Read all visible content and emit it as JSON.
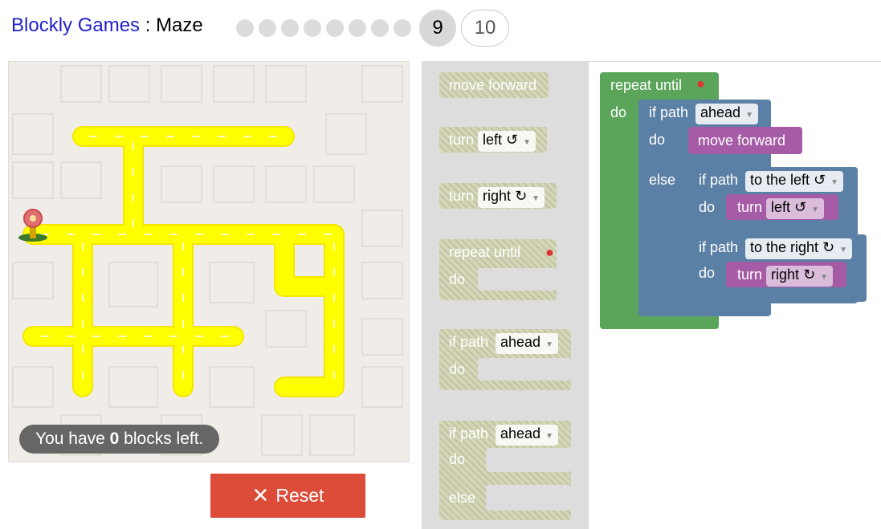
{
  "header": {
    "app_name": "Blockly Games",
    "separator": " : ",
    "game_name": "Maze",
    "current_level": "9",
    "next_level": "10",
    "completed_levels": 8
  },
  "maze": {
    "capacity_prefix": "You have ",
    "capacity_count": "0",
    "capacity_suffix": " blocks left."
  },
  "reset_label": "Reset",
  "toolbox": {
    "move_forward": "move forward",
    "turn": "turn",
    "left": "left ↺",
    "right": "right ↻",
    "repeat_until": "repeat until",
    "do": "do",
    "if_path": "if path",
    "ahead": "ahead",
    "else": "else"
  },
  "workspace": {
    "repeat_until": "repeat until",
    "do": "do",
    "if_path": "if path",
    "ahead": "ahead",
    "move_forward": "move forward",
    "else": "else",
    "to_the_left": "to the left ↺",
    "to_the_right": "to the right ↻",
    "turn": "turn",
    "left": "left ↺",
    "right": "right ↻"
  },
  "colors": {
    "path": "#ffff00",
    "loop_block": "#5ba55b",
    "logic_block": "#5b80a5",
    "action_block": "#a55ba5",
    "reset": "#dd4b39"
  }
}
